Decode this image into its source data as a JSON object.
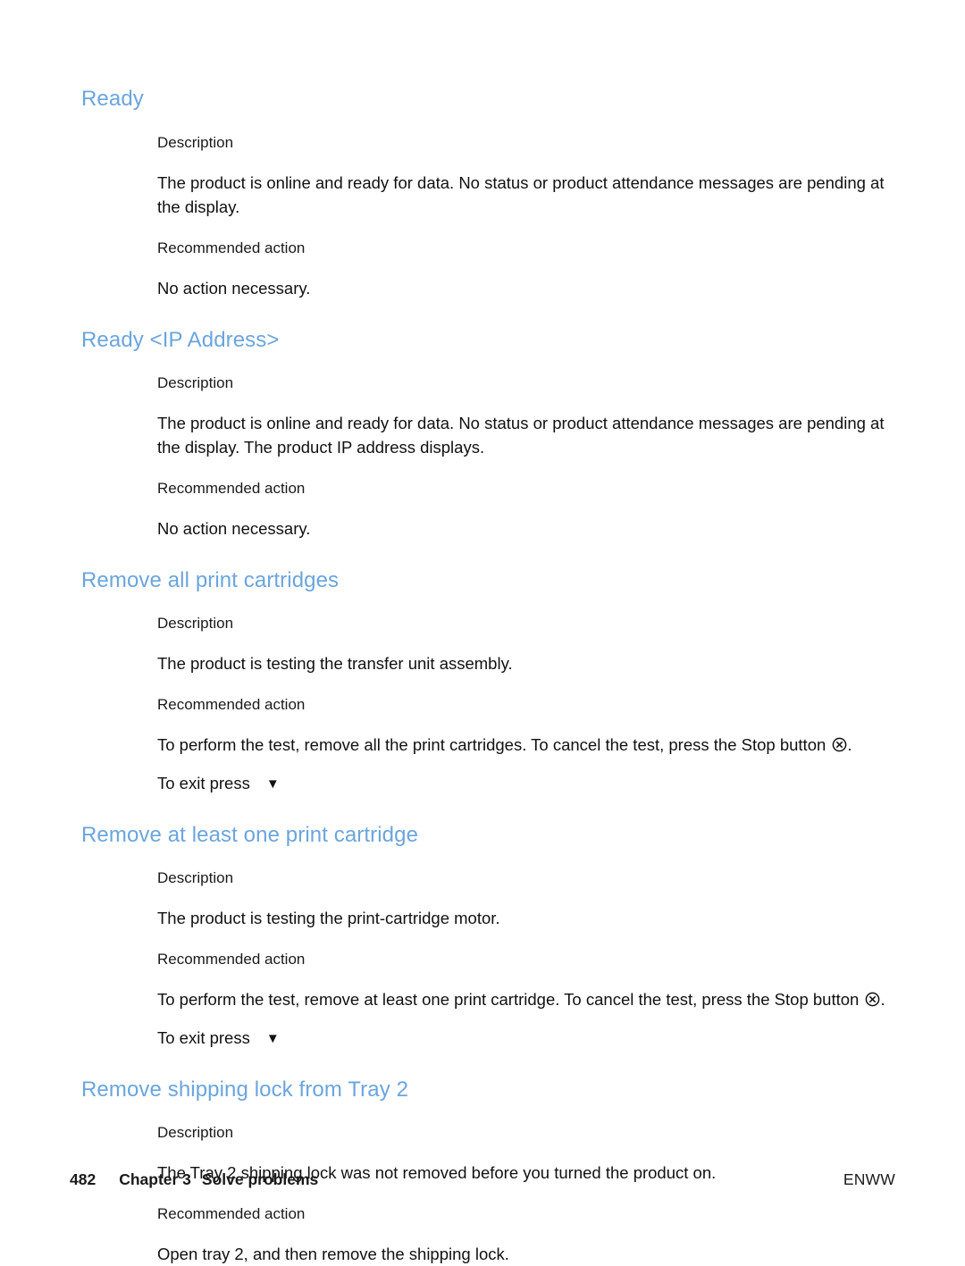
{
  "page": {
    "background_color": "#ffffff",
    "heading_color": "#6ba5dd",
    "text_color": "#111111"
  },
  "sections": [
    {
      "heading": "Ready",
      "description_label": "Description",
      "description_text": "The product is online and ready for data. No status or product attendance messages are pending at the display.",
      "action_label": "Recommended action",
      "action_text": "No action necessary.",
      "exit_text": null,
      "exit_icon": null
    },
    {
      "heading": "Ready <IP Address>",
      "description_label": "Description",
      "description_text": "The product is online and ready for data. No status or product attendance messages are pending at the display. The product IP address displays.",
      "action_label": "Recommended action",
      "action_text": "No action necessary.",
      "exit_text": null,
      "exit_icon": null
    },
    {
      "heading": "Remove all print cartridges",
      "description_label": "Description",
      "description_text": "The product is testing the transfer unit assembly.",
      "action_label": "Recommended action",
      "action_text_part1": "To perform the test, remove all the print cartridges. To cancel the test, press the ",
      "action_text_stop": "Stop",
      "action_text_part2": " button ",
      "action_text_end": ".",
      "stop_icon": "stop-circle-x-icon",
      "exit_text": "To exit press",
      "exit_icon": "down-triangle-icon",
      "exit_icon_glyph": "▼"
    },
    {
      "heading": "Remove at least one print cartridge",
      "description_label": "Description",
      "description_text": "The product is testing the print-cartridge motor.",
      "action_label": "Recommended action",
      "action_text_part1": "To perform the test, remove at least one print cartridge. To cancel the test, press the ",
      "action_text_stop": "Stop",
      "action_text_part2": " button ",
      "action_text_end": ".",
      "stop_icon": "stop-circle-x-icon",
      "exit_text": "To exit press",
      "exit_icon": "down-triangle-icon",
      "exit_icon_glyph": "▼"
    },
    {
      "heading": "Remove shipping lock from Tray 2",
      "description_label": "Description",
      "description_text": "The Tray 2 shipping lock was not removed before you turned the product on.",
      "action_label": "Recommended action",
      "action_text": "Open tray 2, and then remove the shipping lock.",
      "exit_text": null,
      "exit_icon": null
    }
  ],
  "footer": {
    "page_number": "482",
    "chapter": "Chapter 3",
    "chapter_title": "Solve problems",
    "edition_code": "ENWW"
  }
}
